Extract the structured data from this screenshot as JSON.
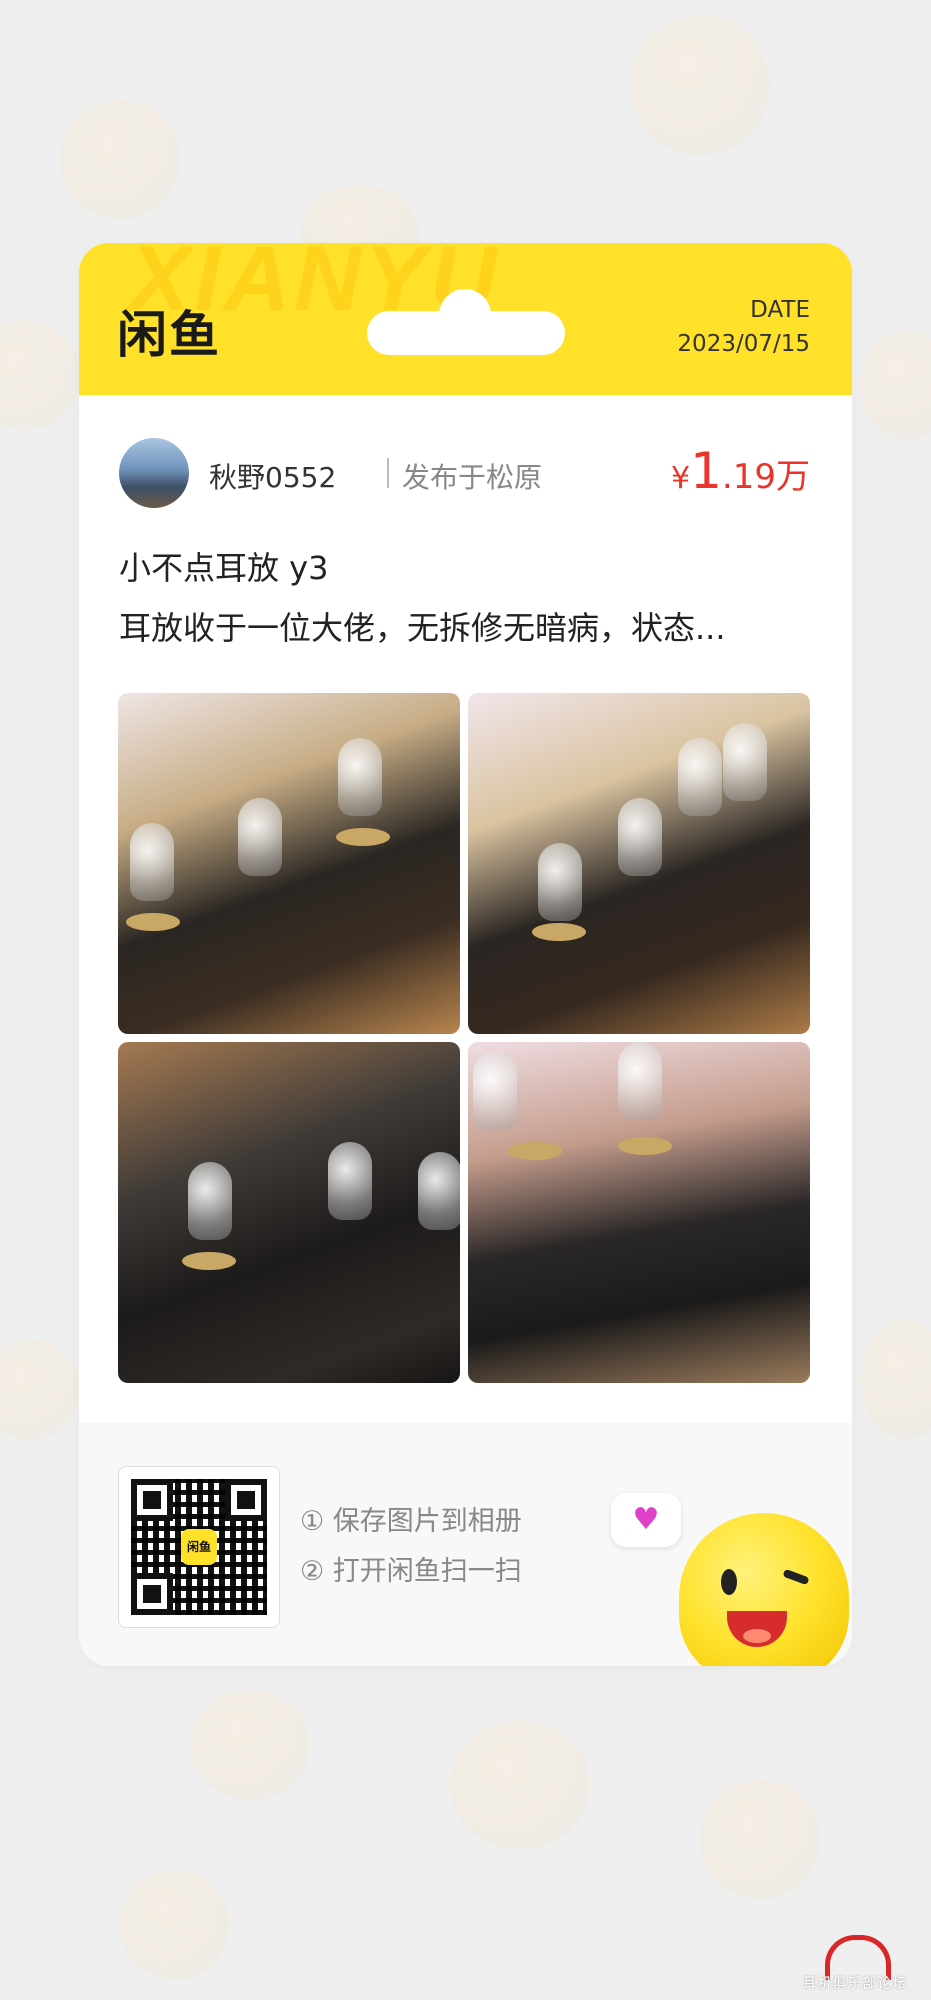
{
  "header": {
    "watermark": "XIANYU",
    "logo_text": "闲鱼",
    "date_label": "DATE",
    "date_value": "2023/07/15"
  },
  "seller": {
    "name": "秋野0552",
    "location": "发布于松原"
  },
  "price": {
    "currency": "¥",
    "integer": "1",
    "decimal": ".19",
    "unit": "万"
  },
  "listing": {
    "title": "小不点耳放 y3",
    "description": "耳放收于一位大佬，无拆修无暗病，状态..."
  },
  "photos": [
    {
      "icon": "photo-tube-amp-1"
    },
    {
      "icon": "photo-tube-amp-2"
    },
    {
      "icon": "photo-tube-amp-3"
    },
    {
      "icon": "photo-tube-amp-4"
    }
  ],
  "footer": {
    "qr_logo": "闲鱼",
    "step1": "① 保存图片到相册",
    "step2": "② 打开闲鱼扫一扫",
    "bubble_icon": "♥"
  },
  "corner_watermark": {
    "text": "耳机俱乐部论坛"
  },
  "colors": {
    "brand_yellow": "#ffe12a",
    "price_red": "#e9352b",
    "background": "#efefef"
  }
}
